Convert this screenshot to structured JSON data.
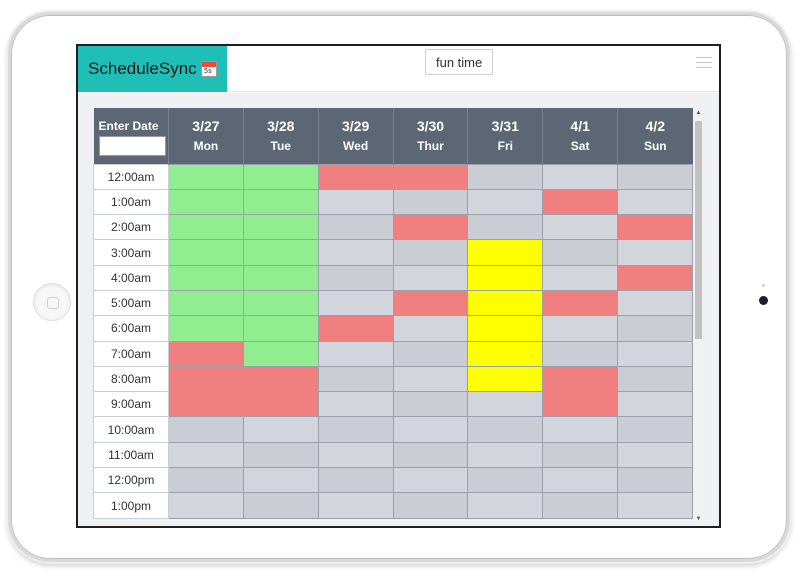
{
  "app": {
    "name": "ScheduleSync",
    "icon": "calendar-icon",
    "icon_text": "5s"
  },
  "header": {
    "event_button_label": "fun time",
    "menu_icon": "hamburger-menu-icon"
  },
  "grid": {
    "corner_label": "Enter Date",
    "date_input_value": "",
    "days": [
      {
        "date": "3/27",
        "name": "Mon"
      },
      {
        "date": "3/28",
        "name": "Tue"
      },
      {
        "date": "3/29",
        "name": "Wed"
      },
      {
        "date": "3/30",
        "name": "Thur"
      },
      {
        "date": "3/31",
        "name": "Fri"
      },
      {
        "date": "4/1",
        "name": "Sat"
      },
      {
        "date": "4/2",
        "name": "Sun"
      }
    ],
    "times": [
      "12:00am",
      "1:00am",
      "2:00am",
      "3:00am",
      "4:00am",
      "5:00am",
      "6:00am",
      "7:00am",
      "8:00am",
      "9:00am",
      "10:00am",
      "11:00am",
      "12:00pm",
      "1:00pm"
    ],
    "status_colors": {
      "free": "#cacdd4",
      "green": "#90ee90",
      "red": "#f08080",
      "yellow": "#ffff00"
    },
    "cells": [
      [
        "green",
        "green",
        "red",
        "red",
        "free",
        "free",
        "free"
      ],
      [
        "green",
        "green",
        "free",
        "free",
        "free",
        "red",
        "free"
      ],
      [
        "green",
        "green",
        "free",
        "red",
        "free",
        "free",
        "red"
      ],
      [
        "green",
        "green",
        "free",
        "free",
        "yellow",
        "free",
        "free"
      ],
      [
        "green",
        "green",
        "free",
        "free",
        "yellow",
        "free",
        "red"
      ],
      [
        "green",
        "green",
        "free",
        "red",
        "yellow",
        "red",
        "free"
      ],
      [
        "green",
        "green",
        "red",
        "free",
        "yellow",
        "free",
        "free"
      ],
      [
        "red",
        "green",
        "free",
        "free",
        "yellow",
        "free",
        "free"
      ],
      [
        "red",
        "red",
        "free",
        "free",
        "yellow",
        "red",
        "free"
      ],
      [
        "red",
        "red",
        "free",
        "free",
        "free",
        "red",
        "free"
      ],
      [
        "free",
        "free",
        "free",
        "free",
        "free",
        "free",
        "free"
      ],
      [
        "free",
        "free",
        "free",
        "free",
        "free",
        "free",
        "free"
      ],
      [
        "free",
        "free",
        "free",
        "free",
        "free",
        "free",
        "free"
      ],
      [
        "free",
        "free",
        "free",
        "free",
        "free",
        "free",
        "free"
      ]
    ]
  }
}
